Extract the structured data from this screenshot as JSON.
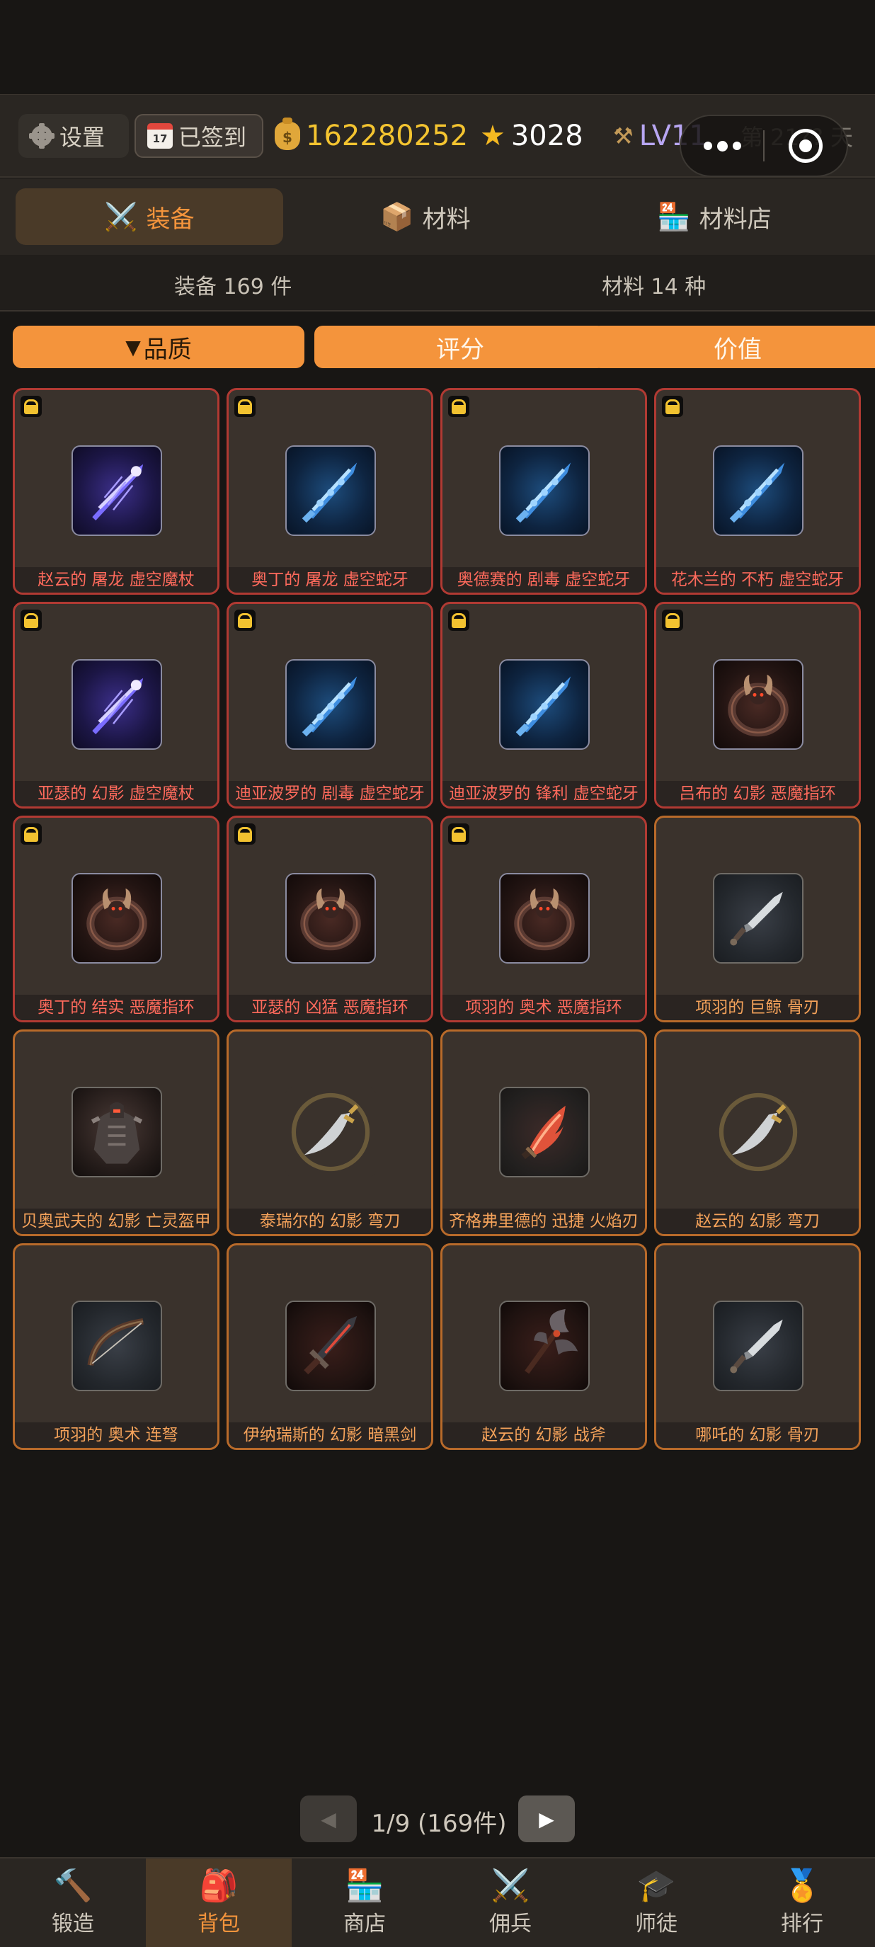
{
  "header": {
    "settings_label": "设置",
    "checkin_label": "已签到",
    "checkin_icon_text": "17",
    "coins": "162280252",
    "stars": "3028",
    "level": "LV11",
    "day": "第 21?? 天"
  },
  "tabs": [
    {
      "label": "装备",
      "icon": "crossed-swords-icon"
    },
    {
      "label": "材料",
      "icon": "package-icon"
    },
    {
      "label": "材料店",
      "icon": "store-icon"
    }
  ],
  "counts": {
    "equipment": "装备 169 件",
    "materials": "材料 14 种"
  },
  "sort": {
    "quality": "品质",
    "quality_arrow": "▼",
    "score": "评分",
    "value": "价值"
  },
  "items": [
    {
      "name": "赵云的 屠龙 虚空魔杖",
      "locked": true,
      "rarity": "red",
      "icon": "void-staff-icon"
    },
    {
      "name": "奥丁的 屠龙 虚空蛇牙",
      "locked": true,
      "rarity": "red",
      "icon": "void-fang-icon"
    },
    {
      "name": "奥德赛的 剧毒 虚空蛇牙",
      "locked": true,
      "rarity": "red",
      "icon": "void-fang-icon"
    },
    {
      "name": "花木兰的 不朽 虚空蛇牙",
      "locked": true,
      "rarity": "red",
      "icon": "void-fang-icon"
    },
    {
      "name": "亚瑟的 幻影 虚空魔杖",
      "locked": true,
      "rarity": "red",
      "icon": "void-staff-icon"
    },
    {
      "name": "迪亚波罗的 剧毒 虚空蛇牙",
      "locked": true,
      "rarity": "red",
      "icon": "void-fang-icon"
    },
    {
      "name": "迪亚波罗的 锋利 虚空蛇牙",
      "locked": true,
      "rarity": "red",
      "icon": "void-fang-icon"
    },
    {
      "name": "吕布的 幻影 恶魔指环",
      "locked": true,
      "rarity": "red",
      "icon": "demon-ring-icon"
    },
    {
      "name": "奥丁的 结实 恶魔指环",
      "locked": true,
      "rarity": "red",
      "icon": "demon-ring-icon"
    },
    {
      "name": "亚瑟的 凶猛 恶魔指环",
      "locked": true,
      "rarity": "red",
      "icon": "demon-ring-icon"
    },
    {
      "name": "项羽的 奥术 恶魔指环",
      "locked": true,
      "rarity": "red",
      "icon": "demon-ring-icon"
    },
    {
      "name": "项羽的 巨鲸 骨刃",
      "locked": false,
      "rarity": "orange",
      "icon": "bone-blade-icon"
    },
    {
      "name": "贝奥武夫的 幻影 亡灵盔甲",
      "locked": false,
      "rarity": "orange",
      "icon": "undead-armor-icon"
    },
    {
      "name": "泰瑞尔的 幻影 弯刀",
      "locked": false,
      "rarity": "orange",
      "icon": "scimitar-icon"
    },
    {
      "name": "齐格弗里德的 迅捷 火焰刃",
      "locked": false,
      "rarity": "orange",
      "icon": "flame-blade-icon"
    },
    {
      "name": "赵云的 幻影 弯刀",
      "locked": false,
      "rarity": "orange",
      "icon": "scimitar-icon"
    },
    {
      "name": "项羽的 奥术 连弩",
      "locked": false,
      "rarity": "orange",
      "icon": "crossbow-icon"
    },
    {
      "name": "伊纳瑞斯的 幻影 暗黑剑",
      "locked": false,
      "rarity": "orange",
      "icon": "dark-sword-icon"
    },
    {
      "name": "赵云的 幻影 战斧",
      "locked": false,
      "rarity": "orange",
      "icon": "battle-axe-icon"
    },
    {
      "name": "哪吒的 幻影 骨刃",
      "locked": false,
      "rarity": "orange",
      "icon": "bone-blade-icon"
    }
  ],
  "pagination": {
    "info": "1/9 (169件)",
    "prev": "◀",
    "next": "▶"
  },
  "nav": [
    {
      "label": "锻造",
      "icon": "hammer-icon"
    },
    {
      "label": "背包",
      "icon": "backpack-icon"
    },
    {
      "label": "商店",
      "icon": "store-icon"
    },
    {
      "label": "佣兵",
      "icon": "crossed-swords-icon"
    },
    {
      "label": "师徒",
      "icon": "graduation-cap-icon"
    },
    {
      "label": "排行",
      "icon": "medal-icon"
    }
  ],
  "colors": {
    "accent": "#f4943c",
    "epic_border": "#b13a33",
    "legendary_border": "#b86a2a",
    "coin": "#f4c430"
  }
}
